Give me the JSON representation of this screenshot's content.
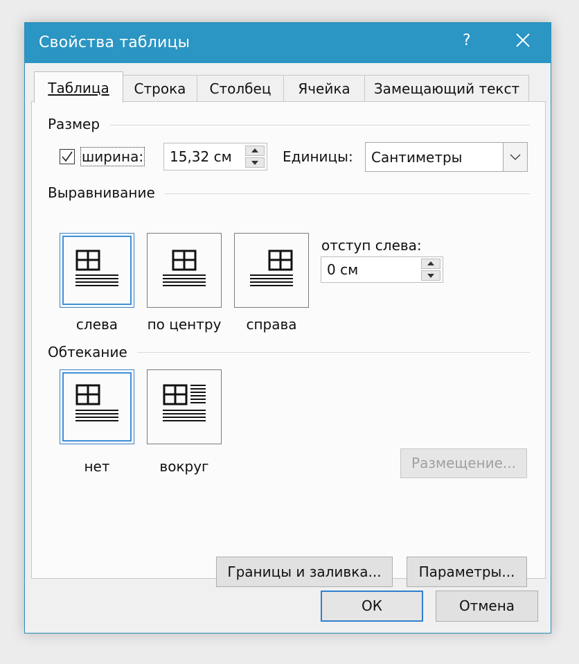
{
  "dialog": {
    "title": "Свойства таблицы",
    "help_label": "?"
  },
  "tabs": [
    {
      "label": "Таблица",
      "active": true
    },
    {
      "label": "Строка",
      "active": false
    },
    {
      "label": "Столбец",
      "active": false
    },
    {
      "label": "Ячейка",
      "active": false
    },
    {
      "label": "Замещающий текст",
      "active": false
    }
  ],
  "size": {
    "group_title": "Размер",
    "width_checked": true,
    "width_label": "ширина:",
    "width_value": "15,32 см",
    "units_label": "Единицы:",
    "units_value": "Сантиметры"
  },
  "alignment": {
    "group_title": "Выравнивание",
    "options": [
      {
        "label": "слева",
        "selected": true
      },
      {
        "label": "по центру",
        "selected": false
      },
      {
        "label": "справа",
        "selected": false
      }
    ],
    "indent_label": "отступ слева:",
    "indent_value": "0 см"
  },
  "wrapping": {
    "group_title": "Обтекание",
    "options": [
      {
        "label": "нет",
        "selected": true
      },
      {
        "label": "вокруг",
        "selected": false
      }
    ],
    "positioning_button": "Размещение..."
  },
  "buttons": {
    "borders": "Границы и заливка...",
    "options": "Параметры...",
    "ok": "ОК",
    "cancel": "Отмена"
  },
  "colors": {
    "title_bar": "#2b95c4",
    "selection_border": "#3d8fdb",
    "default_button_border": "#2f7fd0"
  },
  "icons": [
    "close-icon",
    "help-icon",
    "checkmark-icon",
    "spin-up-icon",
    "spin-down-icon",
    "dropdown-arrow-icon",
    "table-align-left-icon",
    "table-align-center-icon",
    "table-align-right-icon",
    "wrap-none-icon",
    "wrap-around-icon"
  ]
}
